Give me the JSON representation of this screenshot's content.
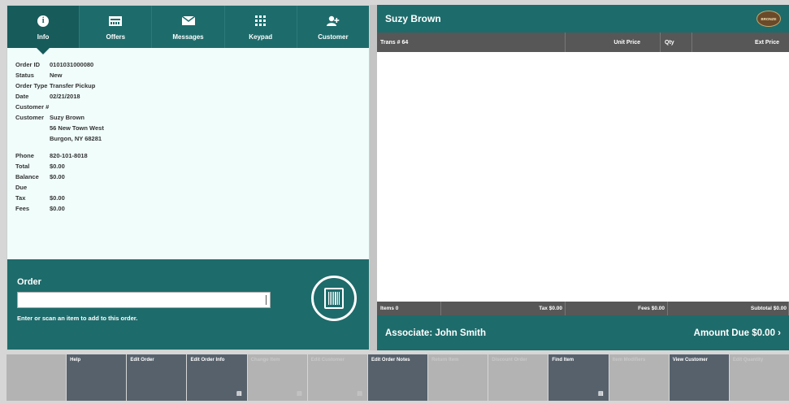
{
  "tabs": [
    {
      "label": "Info",
      "icon": "info-icon"
    },
    {
      "label": "Offers",
      "icon": "offers-icon"
    },
    {
      "label": "Messages",
      "icon": "envelope-icon"
    },
    {
      "label": "Keypad",
      "icon": "keypad-icon"
    },
    {
      "label": "Customer",
      "icon": "add-customer-icon"
    }
  ],
  "order_info": {
    "rows": [
      {
        "label": "Order ID",
        "value": "0101031000080"
      },
      {
        "label": "Status",
        "value": "New"
      },
      {
        "label": "Order Type",
        "value": "Transfer Pickup"
      },
      {
        "label": "Date",
        "value": "02/21/2018"
      },
      {
        "label": "Customer #",
        "value": ""
      },
      {
        "label": "Customer",
        "value": "Suzy Brown"
      },
      {
        "label": "",
        "value": "56 New Town West"
      },
      {
        "label": "",
        "value": "Burgon, NY 68281"
      },
      {
        "label": "Phone",
        "value": "820-101-8018"
      },
      {
        "label": "Total",
        "value": "$0.00"
      },
      {
        "label": "Balance Due",
        "value": "$0.00"
      },
      {
        "label": "Tax",
        "value": "$0.00"
      },
      {
        "label": "Fees",
        "value": "$0.00"
      }
    ]
  },
  "order_entry": {
    "title": "Order",
    "input_value": "",
    "hint": "Enter or scan an item to add to this order."
  },
  "customer_header": {
    "name": "Suzy Brown",
    "logo_text": "BRONZE"
  },
  "table": {
    "headers": {
      "trans": "Trans # 64",
      "unit_price": "Unit Price",
      "qty": "Qty",
      "ext_price": "Ext Price"
    }
  },
  "totals": {
    "items": "Items 0",
    "tax": "Tax $0.00",
    "fees": "Fees $0.00",
    "subtotal": "Subtotal $0.00"
  },
  "footer": {
    "associate": "Associate: John Smith",
    "amount_due": "Amount Due  $0.00  ›"
  },
  "bottom_buttons": [
    {
      "label": "",
      "state": "off",
      "menu": false
    },
    {
      "label": "Help",
      "state": "on",
      "menu": false
    },
    {
      "label": "Edit Order",
      "state": "on",
      "menu": false
    },
    {
      "label": "Edit Order Info",
      "state": "on",
      "menu": true
    },
    {
      "label": "Change Item",
      "state": "off",
      "menu": false
    },
    {
      "label": "Edit Customer",
      "state": "off",
      "menu": true
    },
    {
      "label": "Edit Order Notes",
      "state": "on",
      "menu": false
    },
    {
      "label": "Return Item",
      "state": "off",
      "menu": false
    },
    {
      "label": "Discount Order",
      "state": "off",
      "menu": false
    },
    {
      "label": "Find Item",
      "state": "on",
      "menu": true
    },
    {
      "label": "Item Modifiers",
      "state": "off",
      "menu": false
    },
    {
      "label": "View Customer",
      "state": "on",
      "menu": false
    },
    {
      "label": "Edit Quantity",
      "state": "off",
      "menu": false
    }
  ],
  "colors": {
    "primary": "#1e6b6b",
    "panel_bg": "#f0fdfb",
    "header_gray": "#575757",
    "button_active": "#56616c",
    "button_inactive": "#b3b3b3"
  }
}
